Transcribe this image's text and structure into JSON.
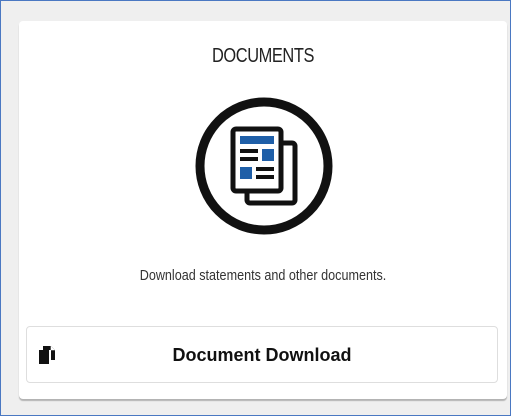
{
  "card": {
    "title": "DOCUMENTS",
    "icon": "documents-icon",
    "description": "Download statements and other documents.",
    "button": {
      "label": "Document Download",
      "icon": "copy-documents-icon"
    }
  },
  "colors": {
    "frame_border": "#4a78c2",
    "icon_accent": "#1f5fa8",
    "icon_dark": "#111111"
  }
}
